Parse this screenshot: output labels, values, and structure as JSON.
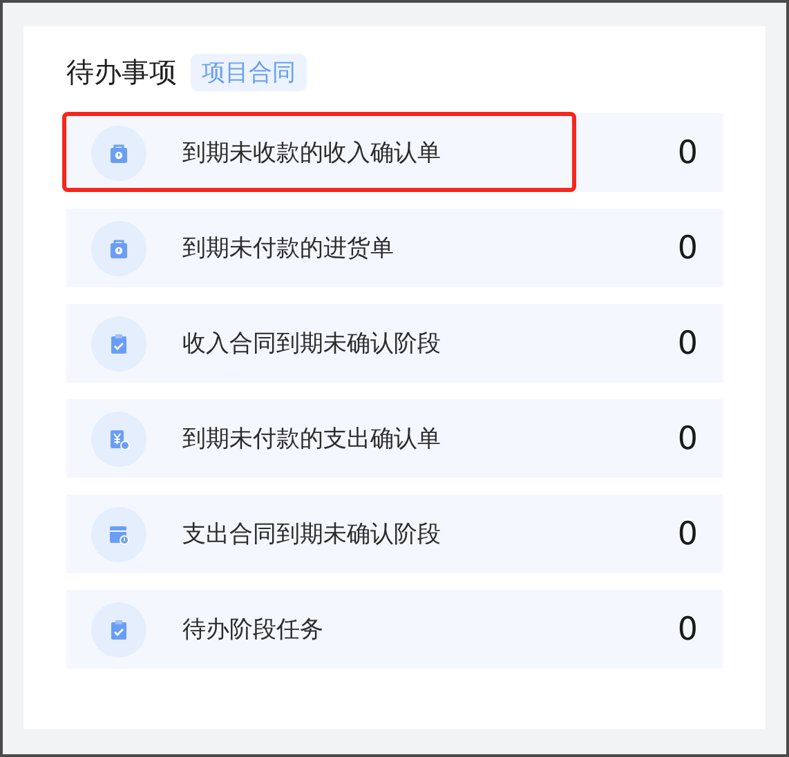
{
  "title": "待办事项",
  "tag": "项目合同",
  "items": [
    {
      "label": "到期未收款的收入确认单",
      "count": "0",
      "kind": "bag",
      "highlighted": true
    },
    {
      "label": "到期未付款的进货单",
      "count": "0",
      "kind": "bag",
      "highlighted": false
    },
    {
      "label": "收入合同到期未确认阶段",
      "count": "0",
      "kind": "clipboard",
      "highlighted": false
    },
    {
      "label": "到期未付款的支出确认单",
      "count": "0",
      "kind": "yen",
      "highlighted": false
    },
    {
      "label": "支出合同到期未确认阶段",
      "count": "0",
      "kind": "calendar",
      "highlighted": false
    },
    {
      "label": "待办阶段任务",
      "count": "0",
      "kind": "clipboard",
      "highlighted": false
    }
  ]
}
